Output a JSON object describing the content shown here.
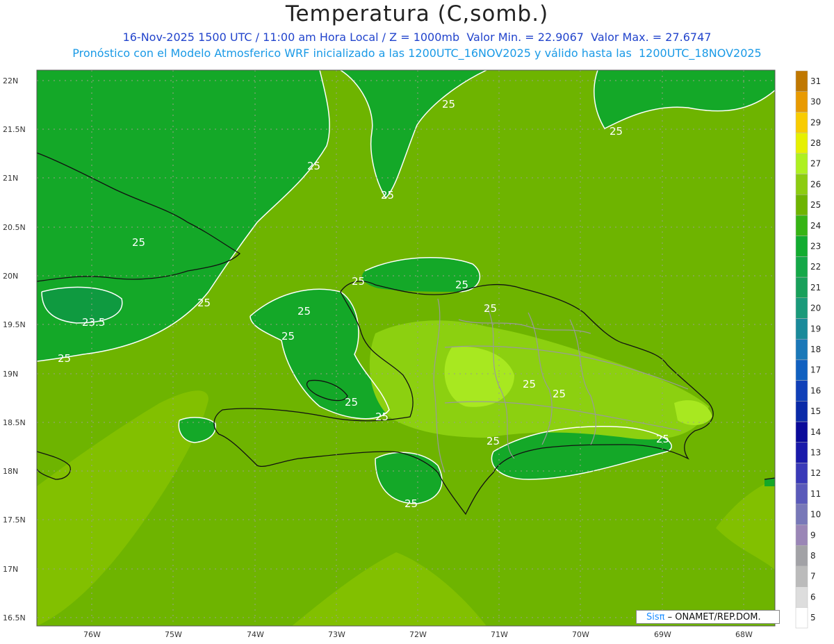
{
  "title": "Temperatura (C,somb.)",
  "subtitle_line1": "16-Nov-2025 1500 UTC / 11:00 am Hora Local / Z = 1000mb  Valor Min. = 22.9067  Valor Max. = 27.6747",
  "subtitle_line2": "Pronóstico con el Modelo Atmosferico WRF inicializado a las 1200UTC_16NOV2025 y válido hasta las  1200UTC_18NOV2025",
  "credit": {
    "brand": "Sisπ",
    "text": " – ONAMET/REP.DOM."
  },
  "map": {
    "lat_ticks": [
      "22N",
      "21.5N",
      "21N",
      "20.5N",
      "20N",
      "19.5N",
      "19N",
      "18.5N",
      "18N",
      "17.5N",
      "17N",
      "16.5N"
    ],
    "lon_ticks": [
      "76W",
      "75W",
      "74W",
      "73W",
      "72W",
      "71W",
      "70W",
      "69W",
      "68W"
    ],
    "contour_labels": [
      "25",
      "25",
      "25",
      "25",
      "25",
      "25",
      "25",
      "25",
      "25",
      "25",
      "25",
      "25",
      "25",
      "25",
      "25",
      "25",
      "23.5"
    ]
  },
  "colorbar": {
    "levels": [
      "5",
      "6",
      "7",
      "8",
      "9",
      "10",
      "11",
      "12",
      "13",
      "14",
      "15",
      "16",
      "17",
      "18",
      "19",
      "20",
      "21",
      "22",
      "23",
      "24",
      "25",
      "26",
      "27",
      "28",
      "29",
      "30",
      "31"
    ],
    "colors": [
      "#ffffff",
      "#dddddd",
      "#bbbbbb",
      "#a2a2a6",
      "#9a86b6",
      "#7878b8",
      "#5a5aba",
      "#3a3ab8",
      "#1a1aaa",
      "#0a0a9a",
      "#0a2aa8",
      "#1040b8",
      "#1060c0",
      "#1a78b8",
      "#1a8a9a",
      "#1a9a7a",
      "#18a05a",
      "#14a848",
      "#12ac30",
      "#36b414",
      "#6eb400",
      "#8ccc10",
      "#aef020",
      "#e6f000",
      "#f8cc00",
      "#e89a00",
      "#c07800"
    ]
  }
}
